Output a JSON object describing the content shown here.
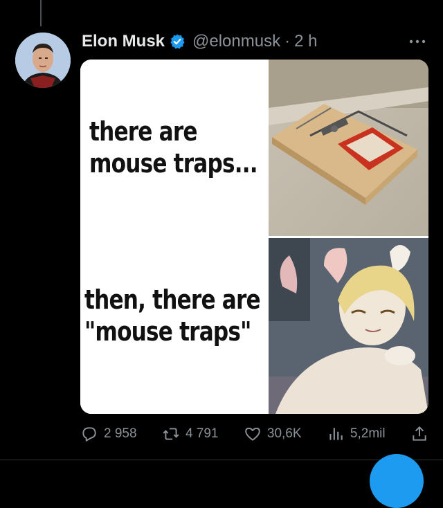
{
  "tweet": {
    "author_name": "Elon Musk",
    "handle": "@elonmusk",
    "separator": "·",
    "time": "2 h",
    "verified_icon": "verified-badge-icon",
    "more_icon": "more-horizontal-icon"
  },
  "media": {
    "caption_top_line1": "there are",
    "caption_top_line2": "mouse traps...",
    "caption_bottom_line1": "then, there are",
    "caption_bottom_line2": "\"mouse traps\""
  },
  "actions": {
    "replies": "2 958",
    "retweets": "4 791",
    "likes": "30,6K",
    "views": "5,2mil",
    "reply_icon": "reply-icon",
    "retweet_icon": "retweet-icon",
    "like_icon": "heart-icon",
    "views_icon": "views-chart-icon",
    "share_icon": "share-icon"
  },
  "colors": {
    "background": "#000000",
    "text_primary": "#e7e9ea",
    "text_secondary": "#8b9298",
    "accent": "#1d9bf0"
  }
}
